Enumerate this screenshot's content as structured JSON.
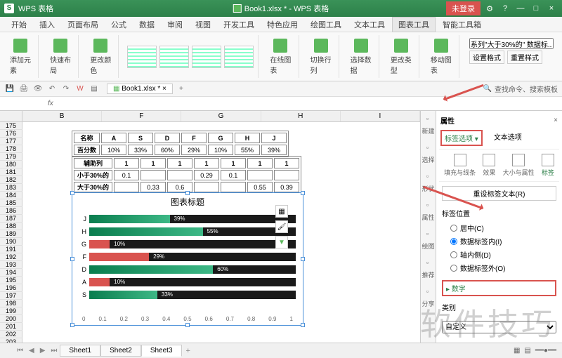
{
  "titlebar": {
    "app": "WPS 表格",
    "doc": "Book1.xlsx * - WPS 表格",
    "login": "未登录"
  },
  "menu": {
    "items": [
      "开始",
      "插入",
      "页面布局",
      "公式",
      "数据",
      "审阅",
      "视图",
      "开发工具",
      "特色应用",
      "绘图工具",
      "文本工具",
      "图表工具",
      "智能工具箱"
    ],
    "active": 11
  },
  "ribbon": {
    "btn1": "添加元素",
    "btn2": "快速布局",
    "btn3": "更改颜色",
    "btn4": "在线图表",
    "btn5": "切换行列",
    "btn6": "选择数据",
    "btn7": "更改类型",
    "btn8": "移动图表",
    "series_label": "系列\"大于30%的\" 数据标...",
    "format_btn": "设置格式",
    "reset_btn": "重置样式"
  },
  "qat": {
    "tab": "Book1.xlsx *",
    "search": "查找命令、搜索模板"
  },
  "table1": {
    "headers": [
      "名称",
      "A",
      "S",
      "D",
      "F",
      "G",
      "H",
      "J"
    ],
    "row_label": "百分数",
    "values": [
      "10%",
      "33%",
      "60%",
      "29%",
      "10%",
      "55%",
      "39%"
    ]
  },
  "table2": {
    "headers": [
      "辅助列",
      "1",
      "1",
      "1",
      "1",
      "1",
      "1",
      "1"
    ],
    "rows": [
      {
        "label": "小于30%的",
        "vals": [
          "0.1",
          "",
          "",
          "0.29",
          "0.1",
          "",
          ""
        ]
      },
      {
        "label": "大于30%的",
        "vals": [
          "",
          "0.33",
          "0.6",
          "",
          "",
          "0.55",
          "0.39"
        ]
      }
    ]
  },
  "chart_data": {
    "type": "bar",
    "title": "图表标题",
    "categories": [
      "J",
      "H",
      "G",
      "F",
      "D",
      "A",
      "S"
    ],
    "xlim": [
      0,
      1
    ],
    "xticks": [
      "0",
      "0.1",
      "0.2",
      "0.3",
      "0.4",
      "0.5",
      "0.6",
      "0.7",
      "0.8",
      "0.9",
      "1"
    ],
    "series": [
      {
        "name": "小于30%的",
        "color": "#d9534f",
        "values": [
          0,
          0,
          0.1,
          0.29,
          0,
          0.1,
          0
        ]
      },
      {
        "name": "大于30%的",
        "color": "#2fae78",
        "values": [
          0.39,
          0.55,
          0,
          0,
          0.6,
          0,
          0.33
        ]
      },
      {
        "name": "辅助列",
        "color": "#1a1a1a",
        "values": [
          0.61,
          0.45,
          0.9,
          0.71,
          0.4,
          0.9,
          0.67
        ]
      }
    ],
    "data_labels": [
      "39%",
      "55%",
      "10%",
      "29%",
      "60%",
      "10%",
      "33%"
    ]
  },
  "props": {
    "title": "属性",
    "tab_label": "标签选项",
    "tab_text": "文本选项",
    "icons": [
      "填充与线条",
      "效果",
      "大小与属性",
      "标签"
    ],
    "reset_btn": "重设标签文本(R)",
    "pos_title": "标签位置",
    "pos_opts": [
      "居中(C)",
      "数据标签内(I)",
      "轴内侧(D)",
      "数据标签外(O)"
    ],
    "pos_selected": 1,
    "num_title": "数字",
    "cat_label": "类别",
    "custom": "自定义"
  },
  "side": {
    "items": [
      "新建",
      "选择",
      "形状",
      "属性",
      "绘图",
      "推荐",
      "分享"
    ]
  },
  "sheets": {
    "tabs": [
      "Sheet1",
      "Sheet2",
      "Sheet3"
    ],
    "active": 2
  },
  "watermark": "软件技巧",
  "rows": [
    "175",
    "176",
    "177",
    "178",
    "179",
    "180",
    "181",
    "182",
    "183",
    "184",
    "185",
    "186",
    "187",
    "188",
    "189",
    "190",
    "191",
    "192",
    "193",
    "194",
    "195",
    "196",
    "197",
    "198",
    "199",
    "200",
    "201",
    "202",
    "203"
  ],
  "cols": [
    "B",
    "F",
    "G",
    "H",
    "I"
  ]
}
